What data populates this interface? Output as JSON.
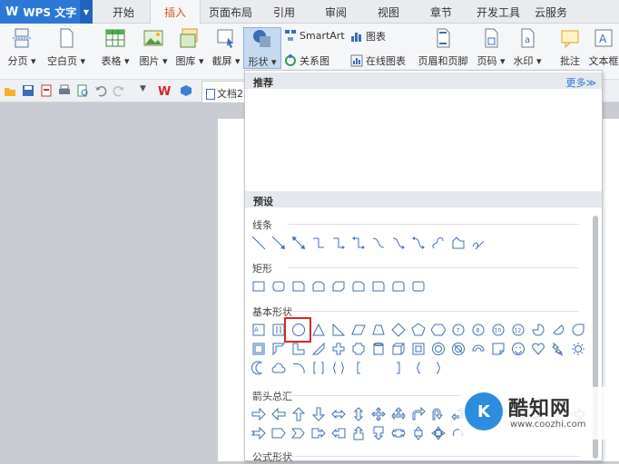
{
  "app": {
    "logo": "W",
    "name": "WPS 文字"
  },
  "tabs": [
    "开始",
    "插入",
    "页面布局",
    "引用",
    "审阅",
    "视图",
    "章节",
    "开发工具",
    "云服务"
  ],
  "active_tab": "插入",
  "ribbon": {
    "page_break": "分页",
    "blank_page": "空白页",
    "table": "表格",
    "picture": "图片",
    "gallery": "图库",
    "screenshot": "截屏",
    "shape": "形状",
    "smartart": "SmartArt",
    "chart": "图表",
    "relation": "关系图",
    "online_chart": "在线图表",
    "header_footer": "页眉和页脚",
    "page_number": "页码",
    "watermark": "水印",
    "comment": "批注",
    "textbox": "文本框"
  },
  "doc_tab": "文档2",
  "dropdown": {
    "recommend": "推荐",
    "more": "更多≫",
    "preset": "预设",
    "categories": [
      "线条",
      "矩形",
      "基本形状",
      "箭头总汇",
      "公式形状"
    ]
  },
  "watermark_site": {
    "logo": "K",
    "name": "酷知网",
    "url": "www.coozhi.com"
  },
  "colors": {
    "accent": "#2d78d7",
    "active_tab_text": "#d0591e",
    "highlight": "#d9252a",
    "shape_stroke": "#3f70b0"
  }
}
